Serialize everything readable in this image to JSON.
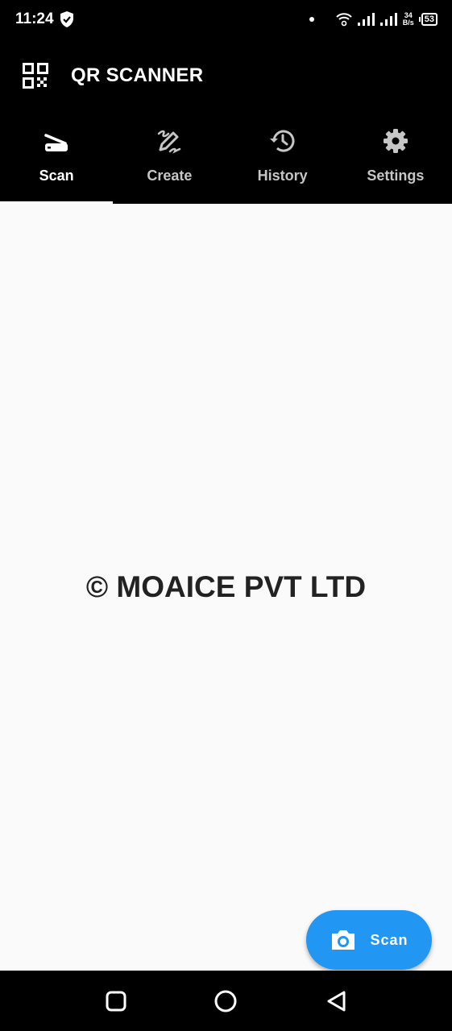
{
  "status_bar": {
    "time": "11:24",
    "net_speed_value": "34",
    "net_speed_unit": "B/s",
    "battery": "53"
  },
  "app_bar": {
    "title": "QR SCANNER"
  },
  "tabs": [
    {
      "label": "Scan",
      "icon": "scanner-icon",
      "active": true
    },
    {
      "label": "Create",
      "icon": "edit-icon",
      "active": false
    },
    {
      "label": "History",
      "icon": "history-icon",
      "active": false
    },
    {
      "label": "Settings",
      "icon": "gear-icon",
      "active": false
    }
  ],
  "main": {
    "copyright": "© MOAICE PVT LTD"
  },
  "fab": {
    "label": "Scan",
    "icon": "camera-icon",
    "color": "#2196f3"
  },
  "colors": {
    "app_bar": "#000000",
    "background": "#fafafa",
    "accent": "#2196f3"
  }
}
